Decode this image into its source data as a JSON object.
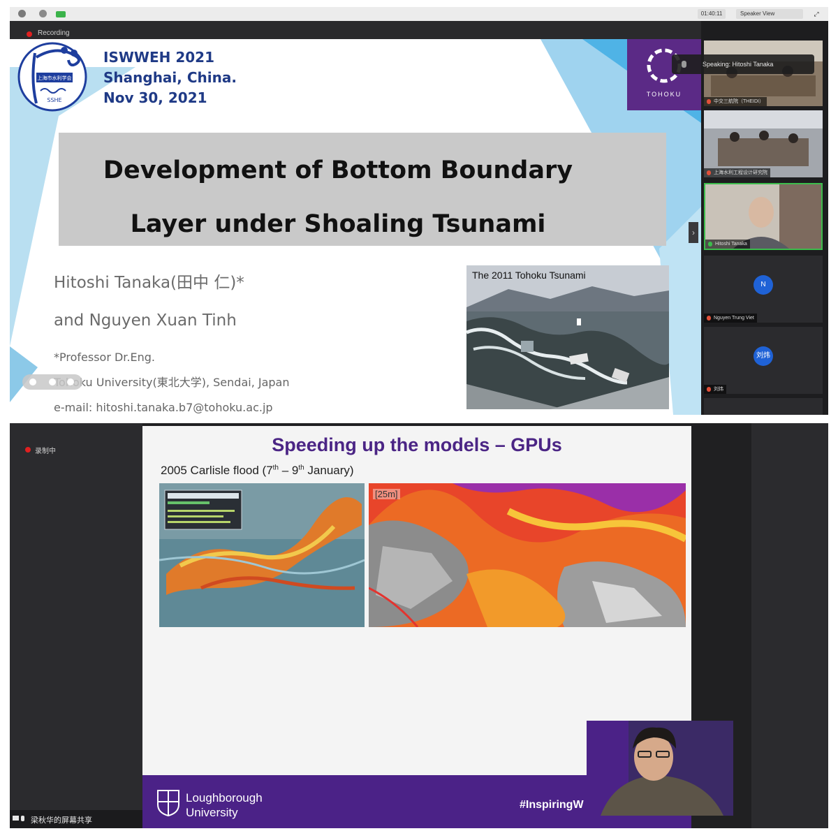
{
  "top_meeting": {
    "timer": "01:40:11",
    "view_label": "Speaker View",
    "recording_label": "Recording",
    "speaking_label": "Speaking: Hitoshi Tanaka",
    "slide": {
      "conference": [
        "ISWWEH 2021",
        "Shanghai, China.",
        "Nov 30, 2021"
      ],
      "org_logo_text": "上海市水利学会",
      "org_logo_abbr": "SSHE",
      "university_logo": "TOHOKU",
      "title_lines": [
        "Development of Bottom Boundary",
        "Layer under Shoaling Tsunami"
      ],
      "authors": [
        "Hitoshi Tanaka(田中 仁)*",
        "and Nguyen Xuan Tinh"
      ],
      "affiliation": [
        "*Professor   Dr.Eng.",
        "Tohoku University(東北大学), Sendai, Japan",
        "e-mail: hitoshi.tanaka.b7@tohoku.ac.jp"
      ],
      "photo_caption": "The 2011 Tohoku Tsunami"
    },
    "participants": [
      {
        "name": "中交三航院（THEIDI）",
        "mic": "muted"
      },
      {
        "name": "上海水利工程设计研究院",
        "mic": "muted"
      },
      {
        "name": "Hitoshi Tanaka",
        "mic": "active"
      },
      {
        "name": "Nguyen Trung Viet",
        "mic": "muted",
        "initial": "N"
      },
      {
        "name": "刘炜",
        "mic": "muted",
        "initial": "刘炜"
      }
    ]
  },
  "bottom_meeting": {
    "recording_label": "录制中",
    "share_label": "梁秋华的屏幕共享",
    "slide": {
      "title": "Speeding up the models – GPUs",
      "subtitle_a": "2005 Carlisle flood (7",
      "sup_a": "th",
      "subtitle_b": " – 9",
      "sup_b": "th",
      "subtitle_c": " January)",
      "scale_tag": "[25m]",
      "university": [
        "Loughborough",
        "University"
      ],
      "hashtag": "#InspiringW"
    }
  },
  "colors": {
    "tohoku_purple": "#5b2a86",
    "loughborough_purple": "#4b2287",
    "conference_blue": "#1f3a86",
    "active_speaker_green": "#3cbc4c"
  }
}
